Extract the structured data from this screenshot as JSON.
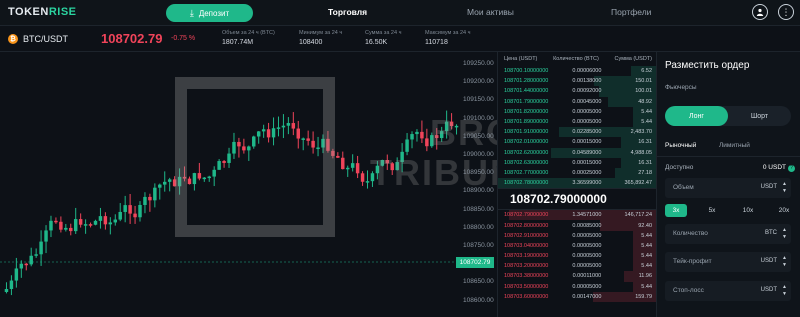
{
  "nav": {
    "logo_a": "TOKEN",
    "logo_b": "RISE",
    "deposit_label": "Депозит",
    "tabs": [
      "Торговля",
      "Мои активы",
      "Портфели"
    ]
  },
  "ticker": {
    "pair": "BTC/USDT",
    "price": "108702.79",
    "change": "-0.75 %",
    "stats": [
      {
        "label": "Объем за 24 ч (BTC)",
        "value": "1807.74M"
      },
      {
        "label": "Минимум за 24 ч",
        "value": "108400"
      },
      {
        "label": "Сумма за 24 ч",
        "value": "16.50K"
      },
      {
        "label": "Максимум за 24 ч",
        "value": "110718"
      }
    ]
  },
  "chart": {
    "yticks": [
      "109250.00",
      "109200.00",
      "109150.00",
      "109100.00",
      "109050.00",
      "109000.00",
      "108950.00",
      "108900.00",
      "108850.00",
      "108800.00",
      "108750.00",
      "108700.00",
      "108650.00",
      "108600.00"
    ],
    "current_price": "108702.79",
    "watermark_a": "BROKER",
    "watermark_b": "TRIBUNAL",
    "up_color": "#1fb88a",
    "down_color": "#f0445a"
  },
  "book": {
    "headers": [
      "Цена (USDT)",
      "Количество (BTC)",
      "Сумма (USDT)"
    ],
    "bids": [
      {
        "price": "108700.10000000",
        "qty": "0.00006000",
        "total": "6.52"
      },
      {
        "price": "108701.28000000",
        "qty": "0.00138000",
        "total": "150.01"
      },
      {
        "price": "108701.44000000",
        "qty": "0.00092000",
        "total": "100.01"
      },
      {
        "price": "108701.79000000",
        "qty": "0.00045000",
        "total": "48.92"
      },
      {
        "price": "108701.82000000",
        "qty": "0.00005000",
        "total": "5.44"
      },
      {
        "price": "108701.89000000",
        "qty": "0.00005000",
        "total": "5.44"
      },
      {
        "price": "108701.91000000",
        "qty": "0.02285000",
        "total": "2,483.70"
      },
      {
        "price": "108702.01000000",
        "qty": "0.00015000",
        "total": "16.31"
      },
      {
        "price": "108702.62000000",
        "qty": "0.04589000",
        "total": "4,988.05"
      },
      {
        "price": "108702.63000000",
        "qty": "0.00015000",
        "total": "16.31"
      },
      {
        "price": "108702.77000000",
        "qty": "0.00025000",
        "total": "27.18"
      },
      {
        "price": "108702.78000000",
        "qty": "3.36599000",
        "total": "365,892.47"
      }
    ],
    "mid": "108702.79000000",
    "asks": [
      {
        "price": "108702.79000000",
        "qty": "1.34571000",
        "total": "146,717.24"
      },
      {
        "price": "108702.80000000",
        "qty": "0.00085000",
        "total": "92.40"
      },
      {
        "price": "108702.91000000",
        "qty": "0.00005000",
        "total": "5.44"
      },
      {
        "price": "108703.04000000",
        "qty": "0.00005000",
        "total": "5.44"
      },
      {
        "price": "108703.19000000",
        "qty": "0.00005000",
        "total": "5.44"
      },
      {
        "price": "108703.20000000",
        "qty": "0.00005000",
        "total": "5.44"
      },
      {
        "price": "108703.38000000",
        "qty": "0.00011000",
        "total": "11.96"
      },
      {
        "price": "108703.50000000",
        "qty": "0.00005000",
        "total": "5.44"
      },
      {
        "price": "108703.60000000",
        "qty": "0.00147000",
        "total": "159.79"
      }
    ]
  },
  "panel": {
    "title": "Разместить ордер",
    "futures": "Фьючерсы",
    "long": "Лонг",
    "short": "Шорт",
    "market": "Рыночный",
    "limit": "Лимитный",
    "available_label": "Доступно",
    "available_value": "0 USDT",
    "volume_label": "Объем",
    "volume_unit": "USDT",
    "leverage": [
      "3x",
      "5x",
      "10x",
      "20x"
    ],
    "qty_label": "Количество",
    "qty_unit": "BTC",
    "tp_label": "Тейк-профит",
    "tp_unit": "USDT",
    "sl_label": "Стоп-лосс",
    "sl_unit": "USDT"
  }
}
